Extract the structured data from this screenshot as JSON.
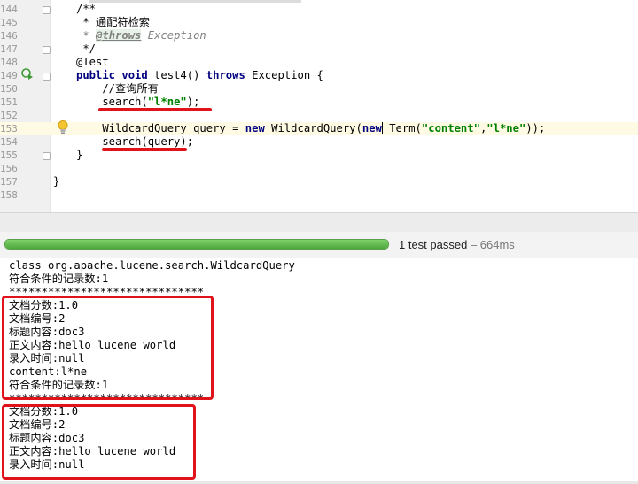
{
  "editor": {
    "lines": [
      {
        "n": "144",
        "code": "/**"
      },
      {
        "n": "145",
        "code": " * 通配符检索"
      },
      {
        "n": "146",
        "code": " * @throws Exception"
      },
      {
        "n": "147",
        "code": " */"
      },
      {
        "n": "148",
        "code": "@Test"
      },
      {
        "n": "149",
        "code": "public void test4() throws Exception {"
      },
      {
        "n": "150",
        "code": "    //查询所有"
      },
      {
        "n": "151",
        "code": "    search(\"l*ne\");"
      },
      {
        "n": "152",
        "code": ""
      },
      {
        "n": "153",
        "code": "    WildcardQuery query = new WildcardQuery(new Term(\"content\",\"l*ne\"));"
      },
      {
        "n": "154",
        "code": "    search(query);"
      },
      {
        "n": "155",
        "code": "}"
      },
      {
        "n": "156",
        "code": ""
      },
      {
        "n": "157",
        "code": "}"
      },
      {
        "n": "158",
        "code": ""
      }
    ],
    "tokens": {
      "l144": "/**",
      "l145": " * 通配符检索",
      "l146_pre": " * ",
      "l146_tag": "@throws",
      "l146_post": " Exception",
      "l147": " */",
      "l148": "@Test",
      "l149_kw1": "public void",
      "l149_mid": " test4() ",
      "l149_kw2": "throws",
      "l149_post": " Exception {",
      "l150": "    //查询所有",
      "l151_pre": "    search(",
      "l151_str": "\"l*ne\"",
      "l151_post": ");",
      "l153_a": "    WildcardQuery query = ",
      "l153_kw1": "new",
      "l153_b": " WildcardQuery(",
      "l153_kw2": "new",
      "l153_c": " Term(",
      "l153_s1": "\"content\"",
      "l153_d": ",",
      "l153_s2": "\"l*ne\"",
      "l153_e": "));",
      "l154": "    search(query);",
      "l155": "}",
      "l157": "}"
    }
  },
  "status": {
    "progress_percent": 100,
    "result_text": "1 test passed",
    "duration_text": " – 664ms"
  },
  "console": {
    "lines": [
      "class org.apache.lucene.search.WildcardQuery",
      "符合条件的记录数:1",
      "******************************",
      "文档分数:1.0",
      "文档编号:2",
      "标题内容:doc3",
      "正文内容:hello lucene world",
      "录入时间:null",
      "content:l*ne",
      "符合条件的记录数:1",
      "******************************",
      "文档分数:1.0",
      "文档编号:2",
      "标题内容:doc3",
      "正文内容:hello lucene world",
      "录入时间:null"
    ]
  },
  "colors": {
    "highlight_red": "#e0131c",
    "keyword": "#000080",
    "string": "#008000",
    "annotation": "#808000",
    "progress_green": "#4fa83d"
  }
}
